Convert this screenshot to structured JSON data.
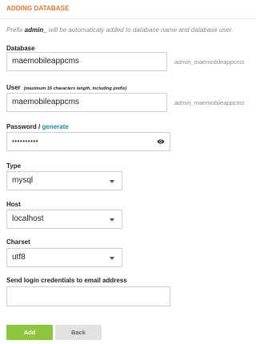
{
  "header": {
    "title": "ADDING DATABASE"
  },
  "note": {
    "before": "Prefix ",
    "prefix": "admin_",
    "after": " will be automaticaly added to database name and database user."
  },
  "fields": {
    "database": {
      "label": "Database",
      "value": "maemobileappcms",
      "full_name": "admin_maemobileappcms"
    },
    "user": {
      "label": "User",
      "hint": "(maximum 16 characters length, including prefix)",
      "value": "maemobileappcms",
      "full_name": "admin_maemobileappcms"
    },
    "password": {
      "label": "Password / ",
      "generate_link": "generate",
      "value": "••••••••••",
      "eye_icon": "eye-icon"
    },
    "type": {
      "label": "Type",
      "selected": "mysql"
    },
    "host": {
      "label": "Host",
      "selected": "localhost"
    },
    "charset": {
      "label": "Charset",
      "selected": "utf8"
    },
    "email": {
      "label": "Send login credentials to email address",
      "value": ""
    }
  },
  "buttons": {
    "add": "Add",
    "back": "Back"
  },
  "colors": {
    "accent": "#e8752e",
    "link": "#1f8a99",
    "add_button": "#8cc63f",
    "back_button": "#e2e2e2"
  }
}
